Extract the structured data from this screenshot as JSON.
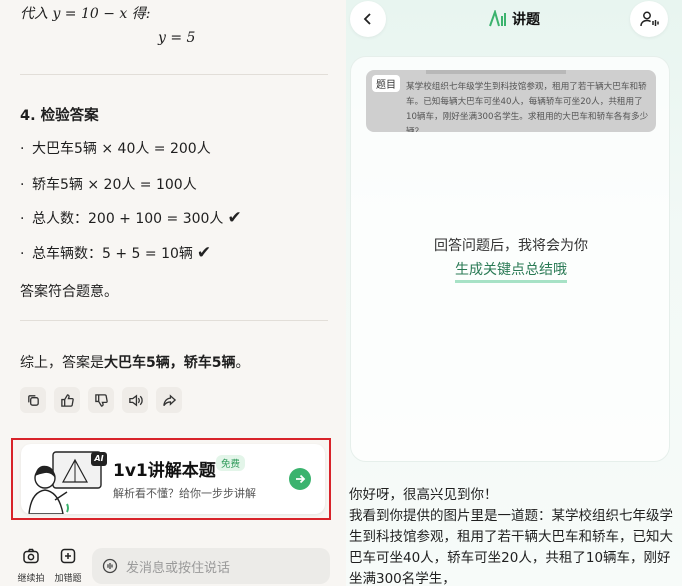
{
  "left": {
    "substitute_text": "代入 y = 10 − x 得:",
    "result_eq": "y = 5",
    "section_title": "4. 检验答案",
    "checks": [
      "大巴车5辆 × 40人 = 200人",
      "轿车5辆 × 20人 = 100人",
      "总人数：200 + 100 = 300人",
      "总车辆数：5 + 5 = 10辆"
    ],
    "check_marks": [
      "",
      "",
      "✔",
      "✔"
    ],
    "conclusion_ok": "答案符合题意。",
    "summary_prefix": "综上，答案是",
    "summary_bold": "大巴车5辆，轿车5辆",
    "summary_suffix": "。",
    "promo": {
      "ai_badge": "AI",
      "title": "1v1讲解本题",
      "badge": "免费",
      "subtitle": "解析看不懂？给你一步步讲解"
    },
    "toolbar": {
      "continue_shoot": "继续拍",
      "add_wrong": "加错题",
      "input_placeholder": "发消息或按住说话"
    }
  },
  "right": {
    "header_title": "讲题",
    "question_tag": "题目",
    "question_text": "某学校组织七年级学生到科技馆参观，租用了若干辆大巴车和轿车。已知每辆大巴车可坐40人，每辆轿车可坐20人，共租用了10辆车，刚好坐满300名学生。求租用的大巴车和轿车各有多少辆？",
    "card_line1": "回答问题后，我将会为你",
    "card_line2": "生成关键点总结哦",
    "reply_lines": [
      "你好呀，很高兴见到你！",
      "我看到你提供的图片里是一道题：某学校组织七年级学生到科技馆参观，租用了若干辆大巴车和轿车，已知大巴车可坐40人，轿车可坐20人，共租了10辆车，刚好坐满300名学生，"
    ]
  },
  "colors": {
    "accent_green": "#3bb36e",
    "highlight_frame": "#d8232a",
    "right_bg": "#e8f5f0"
  }
}
